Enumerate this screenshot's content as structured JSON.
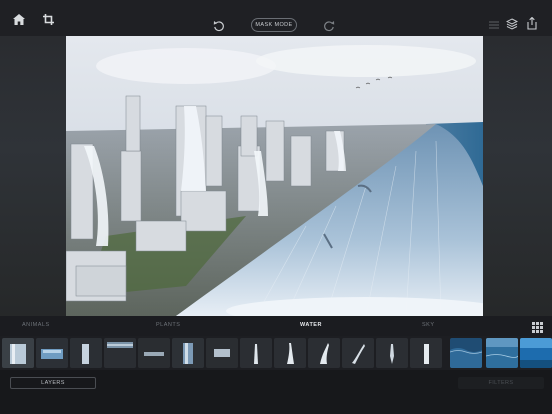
{
  "toolbar": {
    "home_icon": "home-icon",
    "crop_icon": "crop-icon",
    "undo_icon": "undo-icon",
    "mask_mode_label": "MASK MODE",
    "redo_icon": "redo-icon",
    "adjust_icon": "sliders-icon",
    "layers_icon": "layers-stack-icon",
    "share_icon": "share-icon"
  },
  "categories": [
    {
      "label": "ANIMALS",
      "active": false
    },
    {
      "label": "PLANTS",
      "active": false
    },
    {
      "label": "WATER",
      "active": true
    },
    {
      "label": "SKY",
      "active": false
    }
  ],
  "category_grid_icon": "grid-icon",
  "thumbnails": [
    "waterfall-wide",
    "water-splash-blue",
    "waterfall-narrow",
    "water-surface",
    "water-ripple",
    "waterfall-rock",
    "water-spray",
    "water-jet",
    "water-jet-curve",
    "water-splash-tall",
    "water-stream",
    "water-drip",
    "water-fountain",
    "ocean-wave",
    "ocean-surface",
    "underwater-blue"
  ],
  "bottom": {
    "layers_label": "LAYERS",
    "filters_label": "FILTERS"
  },
  "colors": {
    "accent_active": "#e6e8eb",
    "background": "#1a1b1f"
  }
}
